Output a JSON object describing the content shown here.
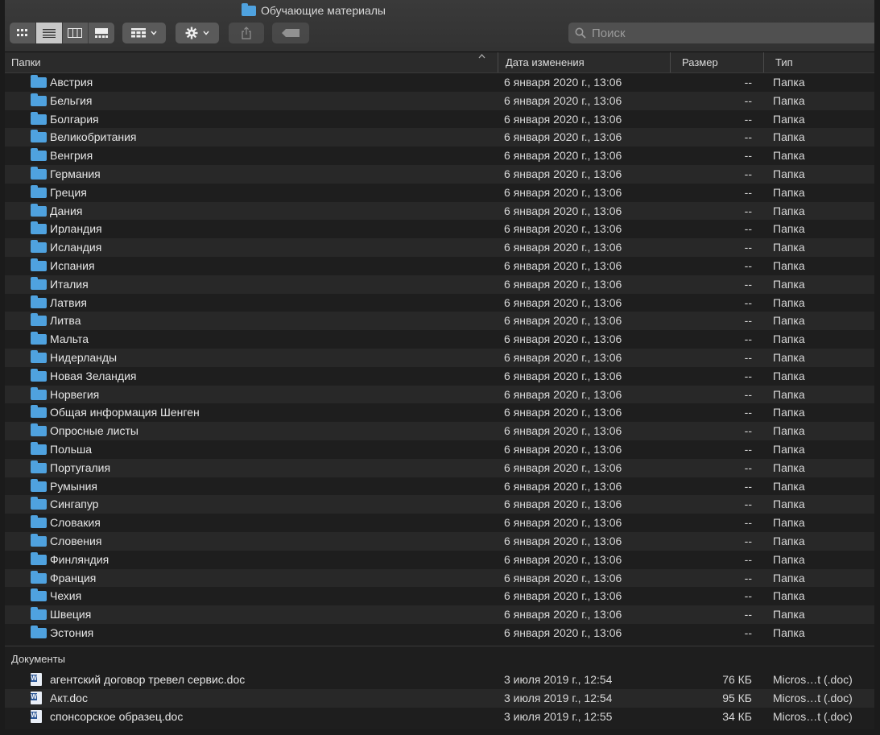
{
  "window": {
    "title": "Обучающие материалы"
  },
  "toolbar": {
    "view_buttons": [
      "icon-view",
      "list-view",
      "column-view",
      "gallery-view"
    ],
    "active_view": "list-view",
    "group_menu_icon": "grid-icon",
    "action_menu_icon": "gear-icon",
    "share_icon": "share-icon",
    "tag_icon": "tag-icon",
    "search_placeholder": "Поиск"
  },
  "columns": {
    "name": "Папки",
    "date": "Дата изменения",
    "size": "Размер",
    "kind": "Тип",
    "sort_indicator": "^"
  },
  "folders": [
    {
      "name": "Австрия",
      "date": "6 января 2020 г., 13:06",
      "size": "--",
      "kind": "Папка"
    },
    {
      "name": "Бельгия",
      "date": "6 января 2020 г., 13:06",
      "size": "--",
      "kind": "Папка"
    },
    {
      "name": "Болгария",
      "date": "6 января 2020 г., 13:06",
      "size": "--",
      "kind": "Папка"
    },
    {
      "name": "Великобритания",
      "date": "6 января 2020 г., 13:06",
      "size": "--",
      "kind": "Папка"
    },
    {
      "name": "Венгрия",
      "date": "6 января 2020 г., 13:06",
      "size": "--",
      "kind": "Папка"
    },
    {
      "name": "Германия",
      "date": "6 января 2020 г., 13:06",
      "size": "--",
      "kind": "Папка"
    },
    {
      "name": "Греция",
      "date": "6 января 2020 г., 13:06",
      "size": "--",
      "kind": "Папка"
    },
    {
      "name": "Дания",
      "date": "6 января 2020 г., 13:06",
      "size": "--",
      "kind": "Папка"
    },
    {
      "name": "Ирландия",
      "date": "6 января 2020 г., 13:06",
      "size": "--",
      "kind": "Папка"
    },
    {
      "name": "Исландия",
      "date": "6 января 2020 г., 13:06",
      "size": "--",
      "kind": "Папка"
    },
    {
      "name": "Испания",
      "date": "6 января 2020 г., 13:06",
      "size": "--",
      "kind": "Папка"
    },
    {
      "name": "Италия",
      "date": "6 января 2020 г., 13:06",
      "size": "--",
      "kind": "Папка"
    },
    {
      "name": "Латвия",
      "date": "6 января 2020 г., 13:06",
      "size": "--",
      "kind": "Папка"
    },
    {
      "name": "Литва",
      "date": "6 января 2020 г., 13:06",
      "size": "--",
      "kind": "Папка"
    },
    {
      "name": "Мальта",
      "date": "6 января 2020 г., 13:06",
      "size": "--",
      "kind": "Папка"
    },
    {
      "name": "Нидерланды",
      "date": "6 января 2020 г., 13:06",
      "size": "--",
      "kind": "Папка"
    },
    {
      "name": "Новая Зеландия",
      "date": "6 января 2020 г., 13:06",
      "size": "--",
      "kind": "Папка"
    },
    {
      "name": "Норвегия",
      "date": "6 января 2020 г., 13:06",
      "size": "--",
      "kind": "Папка"
    },
    {
      "name": "Общая информация Шенген",
      "date": "6 января 2020 г., 13:06",
      "size": "--",
      "kind": "Папка"
    },
    {
      "name": "Опросные листы",
      "date": "6 января 2020 г., 13:06",
      "size": "--",
      "kind": "Папка"
    },
    {
      "name": "Польша",
      "date": "6 января 2020 г., 13:06",
      "size": "--",
      "kind": "Папка"
    },
    {
      "name": "Португалия",
      "date": "6 января 2020 г., 13:06",
      "size": "--",
      "kind": "Папка"
    },
    {
      "name": "Румыния",
      "date": "6 января 2020 г., 13:06",
      "size": "--",
      "kind": "Папка"
    },
    {
      "name": "Сингапур",
      "date": "6 января 2020 г., 13:06",
      "size": "--",
      "kind": "Папка"
    },
    {
      "name": "Словакия",
      "date": "6 января 2020 г., 13:06",
      "size": "--",
      "kind": "Папка"
    },
    {
      "name": "Словения",
      "date": "6 января 2020 г., 13:06",
      "size": "--",
      "kind": "Папка"
    },
    {
      "name": "Финляндия",
      "date": "6 января 2020 г., 13:06",
      "size": "--",
      "kind": "Папка"
    },
    {
      "name": "Франция",
      "date": "6 января 2020 г., 13:06",
      "size": "--",
      "kind": "Папка"
    },
    {
      "name": "Чехия",
      "date": "6 января 2020 г., 13:06",
      "size": "--",
      "kind": "Папка"
    },
    {
      "name": "Швеция",
      "date": "6 января 2020 г., 13:06",
      "size": "--",
      "kind": "Папка"
    },
    {
      "name": "Эстония",
      "date": "6 января 2020 г., 13:06",
      "size": "--",
      "kind": "Папка"
    }
  ],
  "documents_section": {
    "label": "Документы"
  },
  "documents": [
    {
      "name": "агентский договор тревел сервис.doc",
      "date": "3 июля 2019 г., 12:54",
      "size": "76 КБ",
      "kind": "Micros…t (.doc)"
    },
    {
      "name": "Акт.doc",
      "date": "3 июля 2019 г., 12:54",
      "size": "95 КБ",
      "kind": "Micros…t (.doc)"
    },
    {
      "name": "спонсорское образец.doc",
      "date": "3 июля 2019 г., 12:55",
      "size": "34 КБ",
      "kind": "Micros…t (.doc)"
    }
  ],
  "colors": {
    "folder": "#4fa2df",
    "background": "#1e1e1e",
    "row_alt": "#282828",
    "toolbar": "#353535"
  }
}
